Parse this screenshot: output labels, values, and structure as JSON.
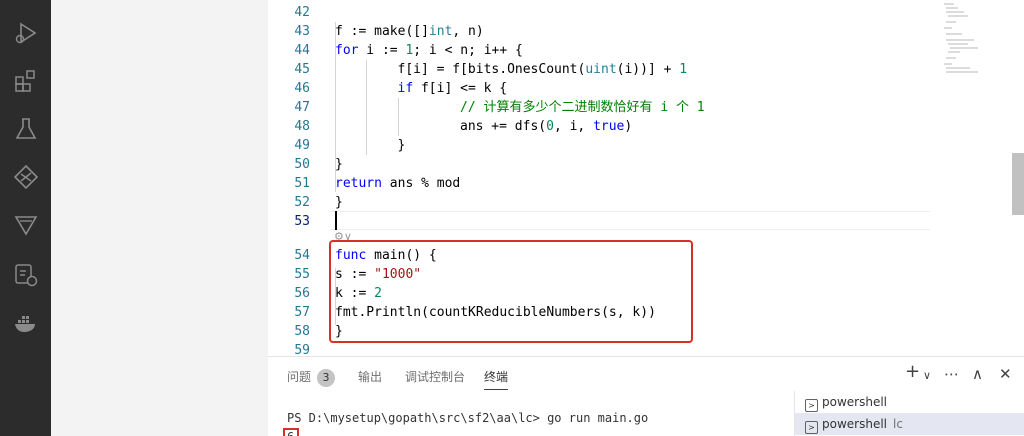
{
  "activity_bar": {
    "icons": [
      "run-debug-icon",
      "extensions-icon",
      "testing-icon",
      "git-graph-icon",
      "deploy-icon",
      "remote-explorer-icon",
      "docker-icon"
    ]
  },
  "editor": {
    "lines": [
      {
        "n": "42",
        "code": ""
      },
      {
        "n": "43",
        "code": "    f := make([]int, n)"
      },
      {
        "n": "44",
        "code": "    for i := 1; i < n; i++ {"
      },
      {
        "n": "45",
        "code": "        f[i] = f[bits.OnesCount(uint(i))] + 1"
      },
      {
        "n": "46",
        "code": "        if f[i] <= k {"
      },
      {
        "n": "47",
        "code": "            // 计算有多少个二进制数恰好有 i 个 1"
      },
      {
        "n": "48",
        "code": "            ans += dfs(0, i, true)"
      },
      {
        "n": "49",
        "code": "        }"
      },
      {
        "n": "50",
        "code": "    }"
      },
      {
        "n": "51",
        "code": "    return ans % mod"
      },
      {
        "n": "52",
        "code": "}"
      },
      {
        "n": "53",
        "code": ""
      },
      {
        "n": "54",
        "code": "func main() {"
      },
      {
        "n": "55",
        "code": "    s := \"1000\""
      },
      {
        "n": "56",
        "code": "    k := 2"
      },
      {
        "n": "57",
        "code": "    fmt.Println(countKReducibleNumbers(s, k))"
      },
      {
        "n": "58",
        "code": "}"
      },
      {
        "n": "59",
        "code": ""
      }
    ],
    "codelens": "⚙∨"
  },
  "panel": {
    "tabs": [
      {
        "label": "问题",
        "badge": "3"
      },
      {
        "label": "输出"
      },
      {
        "label": "调试控制台"
      },
      {
        "label": "终端",
        "active": true
      }
    ],
    "actions": [
      "+",
      "∨",
      "⋯",
      "∧",
      "✕"
    ],
    "terminal": {
      "command_line": "PS D:\\mysetup\\gopath\\src\\sf2\\aa\\lc> go run main.go",
      "output": "6"
    },
    "terminals": [
      {
        "label": "powershell",
        "sub": ""
      },
      {
        "label": "powershell",
        "sub": "lc",
        "selected": true
      }
    ]
  },
  "colors": {
    "activity_bar": "#2c2c2c",
    "highlight_border": "#d93025",
    "keyword": "#0000ff",
    "number": "#098658",
    "string": "#a31515",
    "comment": "#008000"
  }
}
